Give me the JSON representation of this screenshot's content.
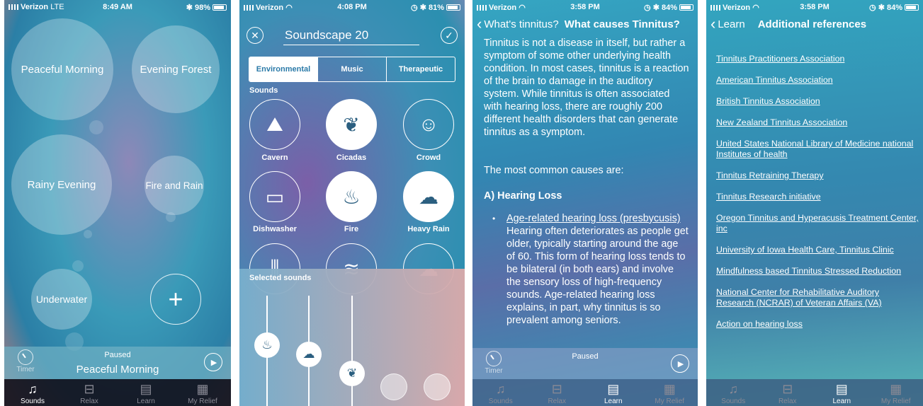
{
  "screens": [
    {
      "status": {
        "carrier": "Verizon",
        "network": "LTE",
        "time": "8:49 AM",
        "battery": "98%"
      },
      "bubbles": [
        "Peaceful Morning",
        "Evening Forest",
        "Rainy Evening",
        "Fire and Rain",
        "Underwater"
      ],
      "add_symbol": "+",
      "player": {
        "timer_label": "Timer",
        "state": "Paused",
        "track": "Peaceful Morning"
      },
      "tabs": [
        "Sounds",
        "Relax",
        "Learn",
        "My Relief"
      ]
    },
    {
      "status": {
        "carrier": "Verizon",
        "time": "4:08 PM",
        "battery": "81%"
      },
      "soundscape_title": "Soundscape 20",
      "segments": [
        "Environmental",
        "Music",
        "Therapeutic"
      ],
      "sounds_label": "Sounds",
      "sounds": [
        "Cavern",
        "Cicadas",
        "Crowd",
        "Dishwasher",
        "Fire",
        "Heavy Rain"
      ],
      "selected_label": "Selected sounds"
    },
    {
      "status": {
        "carrier": "Verizon",
        "time": "3:58 PM",
        "battery": "84%"
      },
      "nav": {
        "back": "What's tinnitus?",
        "title": "What causes Tinnitus?"
      },
      "paragraph": "Tinnitus is not a disease in itself, but rather a symptom of some other underlying health condition. In most cases, tinnitus is a reaction of the brain to damage in the auditory system. While tinnitus is often associated with hearing loss, there are roughly 200 different health disorders that can generate tinnitus as a symptom.",
      "common": "The most common causes are:",
      "heading": "A) Hearing Loss",
      "bullet_link": "Age-related hearing loss (presbycusis)",
      "bullet_text": "Hearing often deteriorates as people get older, typically starting around the age of 60. This form of hearing loss tends to be bilateral (in both ears) and involve the sensory loss of high-frequency sounds. Age-related hearing loss explains, in part, why tinnitus is so prevalent among seniors.",
      "player": {
        "timer_label": "Timer",
        "state": "Paused"
      },
      "tabs": [
        "Sounds",
        "Relax",
        "Learn",
        "My Relief"
      ]
    },
    {
      "status": {
        "carrier": "Verizon",
        "time": "3:58 PM",
        "battery": "84%"
      },
      "nav": {
        "back": "Learn",
        "title": "Additional references"
      },
      "refs": [
        "Tinnitus Practitioners Association",
        "American Tinnitus Association",
        "British Tinnitus Association",
        "New Zealand Tinnitus Association",
        "United States National Library of Medicine national Institutes of health",
        "Tinnitus Retraining Therapy",
        "Tinnitus Research initiative",
        "Oregon Tinnitus and Hyperacusis Treatment Center, inc",
        "University of Iowa Health Care, Tinnitus Clinic",
        "Mindfulness based Tinnitus Stressed Reduction",
        "National Center for Rehabilitative Auditory Research (NCRAR) of Veteran Affairs (VA)",
        "Action on hearing loss"
      ],
      "tabs": [
        "Sounds",
        "Relax",
        "Learn",
        "My Relief"
      ]
    }
  ],
  "icons": {
    "music": "♫",
    "relax": "⊟",
    "learn": "▤",
    "relief": "▦",
    "play": "▶",
    "close": "✕",
    "check": "✓",
    "back": "‹"
  }
}
